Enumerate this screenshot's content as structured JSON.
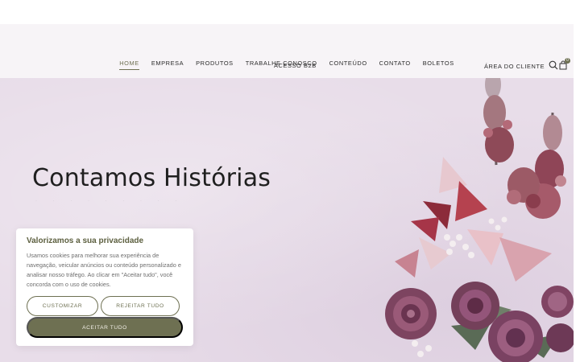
{
  "nav": {
    "items": [
      {
        "label": "HOME",
        "active": true
      },
      {
        "label": "EMPRESA"
      },
      {
        "label": "PRODUTOS"
      },
      {
        "label": "TRABALHE CONOSCO"
      },
      {
        "label": "CONTEÚDO"
      },
      {
        "label": "CONTATO"
      },
      {
        "label": "BOLETOS"
      }
    ],
    "b2b_label": "ACESSO B2B",
    "client_area_label": "ÁREA DO CLIENTE",
    "cart_count": "0"
  },
  "hero": {
    "title": "Contamos Histórias",
    "background_color": "#e8dde9"
  },
  "cookie": {
    "title": "Valorizamos a sua privacidade",
    "text": "Usamos cookies para melhorar sua experiência de navegação, veicular anúncios ou conteúdo personalizado e analisar nosso tráfego. Ao clicar em \"Aceitar tudo\", você concorda com o uso de cookies.",
    "customize_label": "CUSTOMIZAR",
    "reject_label": "REJEITAR TUDO",
    "accept_label": "ACEITAR TUDO",
    "accent_color": "#6e7052"
  },
  "icons": {
    "search": "search-icon",
    "cart": "shopping-bag-icon"
  }
}
